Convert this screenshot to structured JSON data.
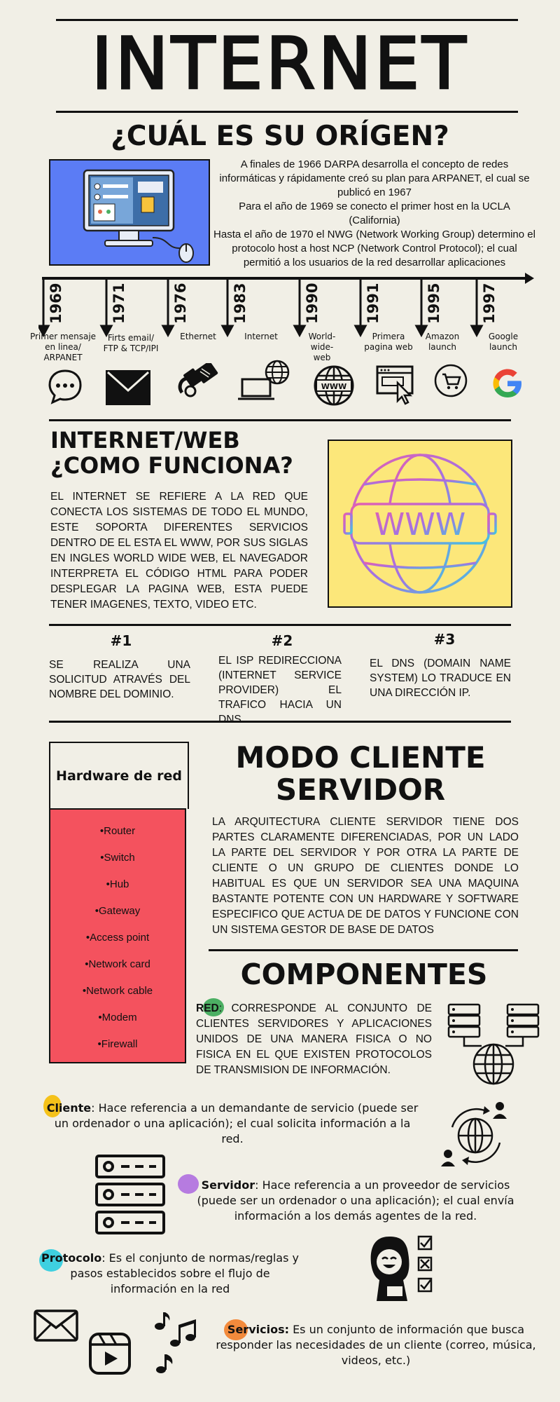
{
  "title": "INTERNET",
  "origin": {
    "heading": "¿CUÁL ES SU ORÍGEN?",
    "p1": "A finales de 1966 DARPA desarrolla el concepto de redes informáticas y rápidamente creó su plan para ARPANET, el cual se publicó en 1967",
    "p2": "Para el año de 1969 se conecto el primer host en la UCLA (California)",
    "p3": "Hasta el año de 1970 el NWG (Network Working Group) determino el protocolo host a host NCP (Network Control Protocol); el cual permitió a los usuarios de la red desarrollar aplicaciones"
  },
  "timeline": [
    {
      "year": "1969",
      "label": "Primer mensaje en linea/ ARPANET",
      "icon": "chat-bubble-icon"
    },
    {
      "year": "1971",
      "label": "Firts email/ FTP & TCP/IPI",
      "icon": "envelope-icon"
    },
    {
      "year": "1976",
      "label": "Ethernet",
      "icon": "ethernet-cable-icon"
    },
    {
      "year": "1983",
      "label": "Internet",
      "icon": "laptop-globe-icon"
    },
    {
      "year": "1990",
      "label": "World-wide-web",
      "icon": "www-globe-icon"
    },
    {
      "year": "1991",
      "label": "Primera pagina web",
      "icon": "browser-cursor-icon"
    },
    {
      "year": "1995",
      "label": "Amazon launch",
      "icon": "shopping-cart-icon"
    },
    {
      "year": "1997",
      "label": "Google launch",
      "icon": "google-logo-icon"
    }
  ],
  "web": {
    "heading1": "INTERNET/WEB",
    "heading2": "¿COMO FUNCIONA?",
    "text": "EL INTERNET SE REFIERE A LA RED QUE CONECTA LOS SISTEMAS DE TODO EL MUNDO, ESTE SOPORTA DIFERENTES SERVICIOS DENTRO DE EL ESTA EL WWW, POR SUS SIGLAS EN INGLES WORLD WIDE WEB, EL NAVEGADOR INTERPRETA EL CÓDIGO HTML PARA PODER DESPLEGAR LA PAGINA WEB, ESTA PUEDE TENER IMAGENES, TEXTO, VIDEO ETC.",
    "www": "WWW"
  },
  "steps": [
    {
      "num": "#1",
      "text": "SE REALIZA UNA SOLICITUD ATRAVÉS DEL NOMBRE DEL DOMINIO."
    },
    {
      "num": "#2",
      "text": "EL ISP REDIRECCIONA (INTERNET SERVICE PROVIDER) EL TRAFICO HACIA UN DNS."
    },
    {
      "num": "#3",
      "text": "EL DNS (DOMAIN NAME SYSTEM) LO TRADUCE EN UNA DIRECCIÓN IP."
    }
  ],
  "hardware": {
    "title": "Hardware de red",
    "items": [
      "•Router",
      "•Switch",
      "•Hub",
      "•Gateway",
      "•Access point",
      "•Network card",
      "•Network cable",
      "•Modem",
      "•Firewall"
    ]
  },
  "cliente_servidor": {
    "heading1": "MODO CLIENTE",
    "heading2": "SERVIDOR",
    "text": "LA ARQUITECTURA CLIENTE SERVIDOR TIENE DOS PARTES CLARAMENTE DIFERENCIADAS, POR UN LADO LA PARTE DEL SERVIDOR Y POR OTRA LA PARTE DE CLIENTE O UN GRUPO DE CLIENTES DONDE LO HABITUAL ES QUE UN SERVIDOR SEA UNA MAQUINA BASTANTE POTENTE CON UN HARDWARE Y SOFTWARE ESPECIFICO QUE ACTUA DE DE DATOS Y FUNCIONE CON UN SISTEMA GESTOR DE BASE DE DATOS"
  },
  "componentes": {
    "heading": "COMPONENTES",
    "red_term": "RED",
    "red_text": ": CORRESPONDE AL CONJUNTO DE CLIENTES SERVIDORES Y APLICACIONES UNIDOS DE UNA MANERA FISICA O NO FISICA EN EL QUE EXISTEN PROTOCOLOS DE TRANSMISION DE INFORMACIÓN.",
    "cliente_term": "Cliente",
    "cliente_text": ": Hace referencia a un demandante de servicio (puede ser un ordenador o una aplicación); el cual solicita información a la red.",
    "servidor_term": "Servidor",
    "servidor_text": ": Hace referencia a un proveedor de servicios (puede ser un ordenador o una aplicación); el cual envía información a los demás agentes de la red.",
    "protocolo_term": "Protocolo",
    "protocolo_text": ": Es el conjunto de normas/reglas y pasos establecidos sobre el flujo de información en la red",
    "servicios_term": "Servicios:",
    "servicios_text": " Es un conjunto de información que busca responder las necesidades de un cliente (correo, música, videos, etc.)"
  },
  "colors": {
    "background": "#f1efe6",
    "computer_box": "#5b7cf5",
    "www_box": "#fce77a",
    "hardware_box": "#f4525e",
    "blob_red": "#4caf63",
    "blob_cliente": "#f5c21a",
    "blob_servidor": "#b67be0",
    "blob_protocolo": "#3fd0e0",
    "blob_servicios": "#f28a3c"
  }
}
